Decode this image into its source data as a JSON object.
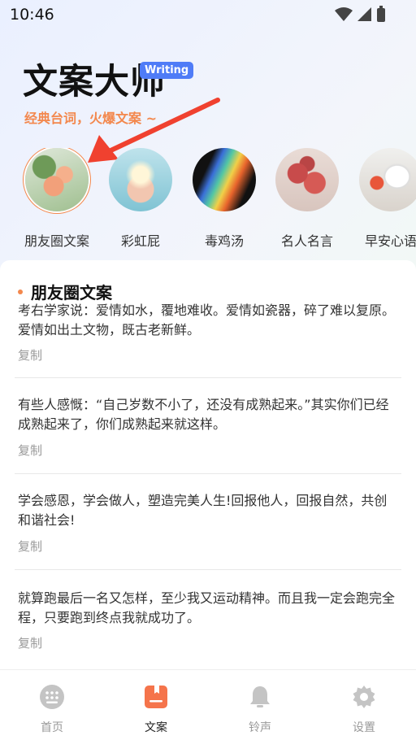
{
  "status": {
    "time": "10:46"
  },
  "header": {
    "title": "文案大师",
    "badge": "Writing",
    "subtitle": "经典台词，火爆文案 ~"
  },
  "categories": [
    {
      "label": "朋友圈文案",
      "selected": true,
      "image": "roses-photo"
    },
    {
      "label": "彩虹屁",
      "selected": false,
      "image": "hands-sparkle-photo"
    },
    {
      "label": "毒鸡汤",
      "selected": false,
      "image": "rainbow-prism-photo"
    },
    {
      "label": "名人名言",
      "selected": false,
      "image": "carnations-photo"
    },
    {
      "label": "早安心语",
      "selected": false,
      "image": "coffee-tulip-photo"
    }
  ],
  "content": {
    "section_title": "朋友圈文案",
    "items": [
      {
        "text": "考右学家说：爱情如水，覆地难收。爱情如瓷器，碎了难以复原。爱情如出土文物，既古老新鲜。",
        "copy": "复制"
      },
      {
        "text": "有些人感慨：“自己岁数不小了，还没有成熟起来。”其实你们已经成熟起来了，你们成熟起来就这样。",
        "copy": "复制"
      },
      {
        "text": "学会感恩，学会做人，塑造完美人生!回报他人，回报自然，共创和谐社会!",
        "copy": "复制"
      },
      {
        "text": "就算跑最后一名又怎样，至少我又运动精神。而且我一定会跑完全程，只要跑到终点我就成功了。",
        "copy": "复制"
      }
    ]
  },
  "tabbar": {
    "tabs": [
      {
        "label": "首页",
        "icon": "home-grid-icon",
        "active": false
      },
      {
        "label": "文案",
        "icon": "document-icon",
        "active": true
      },
      {
        "label": "铃声",
        "icon": "bell-icon",
        "active": false
      },
      {
        "label": "设置",
        "icon": "gear-icon",
        "active": false
      }
    ]
  },
  "colors": {
    "accent": "#f3884d",
    "badge": "#4f7cf7",
    "active_tab": "#f5744b"
  }
}
